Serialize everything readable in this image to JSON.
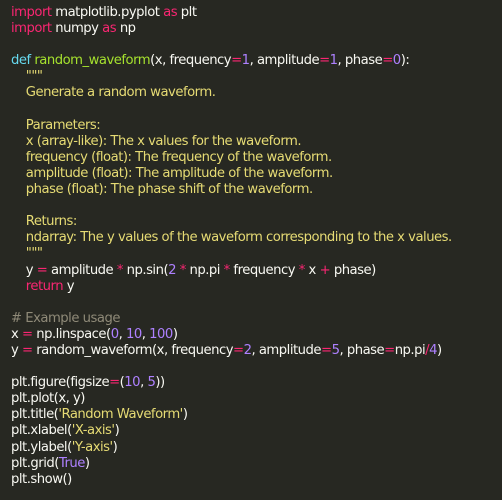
{
  "colors": {
    "background": "#272822",
    "text": "#f8f8f2",
    "keyword": "#f92672",
    "definition": "#66d9ef",
    "function_name": "#a6e22e",
    "number": "#ae81ff",
    "string": "#e6db74",
    "comment": "#8f8a78"
  },
  "code_lines": [
    [
      {
        "t": "kw",
        "v": "import"
      },
      {
        "t": "txt",
        "v": " matplotlib.pyplot "
      },
      {
        "t": "kw",
        "v": "as"
      },
      {
        "t": "txt",
        "v": " plt"
      }
    ],
    [
      {
        "t": "kw",
        "v": "import"
      },
      {
        "t": "txt",
        "v": " numpy "
      },
      {
        "t": "kw",
        "v": "as"
      },
      {
        "t": "txt",
        "v": " np"
      }
    ],
    [],
    [
      {
        "t": "def",
        "v": "def"
      },
      {
        "t": "txt",
        "v": " "
      },
      {
        "t": "fn",
        "v": "random_waveform"
      },
      {
        "t": "txt",
        "v": "(x, frequency"
      },
      {
        "t": "op",
        "v": "="
      },
      {
        "t": "num",
        "v": "1"
      },
      {
        "t": "txt",
        "v": ", amplitude"
      },
      {
        "t": "op",
        "v": "="
      },
      {
        "t": "num",
        "v": "1"
      },
      {
        "t": "txt",
        "v": ", phase"
      },
      {
        "t": "op",
        "v": "="
      },
      {
        "t": "num",
        "v": "0"
      },
      {
        "t": "txt",
        "v": "):"
      }
    ],
    [
      {
        "t": "str",
        "v": "    \"\"\""
      }
    ],
    [
      {
        "t": "str",
        "v": "    Generate a random waveform."
      }
    ],
    [],
    [
      {
        "t": "str",
        "v": "    Parameters:"
      }
    ],
    [
      {
        "t": "str",
        "v": "    x (array-like): The x values for the waveform."
      }
    ],
    [
      {
        "t": "str",
        "v": "    frequency (float): The frequency of the waveform."
      }
    ],
    [
      {
        "t": "str",
        "v": "    amplitude (float): The amplitude of the waveform."
      }
    ],
    [
      {
        "t": "str",
        "v": "    phase (float): The phase shift of the waveform."
      }
    ],
    [],
    [
      {
        "t": "str",
        "v": "    Returns:"
      }
    ],
    [
      {
        "t": "str",
        "v": "    ndarray: The y values of the waveform corresponding to the x values."
      }
    ],
    [
      {
        "t": "str",
        "v": "    \"\"\""
      }
    ],
    [
      {
        "t": "txt",
        "v": "    y "
      },
      {
        "t": "op",
        "v": "="
      },
      {
        "t": "txt",
        "v": " amplitude "
      },
      {
        "t": "op",
        "v": "*"
      },
      {
        "t": "txt",
        "v": " np.sin("
      },
      {
        "t": "num",
        "v": "2"
      },
      {
        "t": "txt",
        "v": " "
      },
      {
        "t": "op",
        "v": "*"
      },
      {
        "t": "txt",
        "v": " np.pi "
      },
      {
        "t": "op",
        "v": "*"
      },
      {
        "t": "txt",
        "v": " frequency "
      },
      {
        "t": "op",
        "v": "*"
      },
      {
        "t": "txt",
        "v": " x "
      },
      {
        "t": "op",
        "v": "+"
      },
      {
        "t": "txt",
        "v": " phase)"
      }
    ],
    [
      {
        "t": "kw",
        "v": "    return"
      },
      {
        "t": "txt",
        "v": " y"
      }
    ],
    [],
    [
      {
        "t": "com",
        "v": "# Example usage"
      }
    ],
    [
      {
        "t": "txt",
        "v": "x "
      },
      {
        "t": "op",
        "v": "="
      },
      {
        "t": "txt",
        "v": " np.linspace("
      },
      {
        "t": "num",
        "v": "0"
      },
      {
        "t": "txt",
        "v": ", "
      },
      {
        "t": "num",
        "v": "10"
      },
      {
        "t": "txt",
        "v": ", "
      },
      {
        "t": "num",
        "v": "100"
      },
      {
        "t": "txt",
        "v": ")"
      }
    ],
    [
      {
        "t": "txt",
        "v": "y "
      },
      {
        "t": "op",
        "v": "="
      },
      {
        "t": "txt",
        "v": " random_waveform(x, frequency"
      },
      {
        "t": "op",
        "v": "="
      },
      {
        "t": "num",
        "v": "2"
      },
      {
        "t": "txt",
        "v": ", amplitude"
      },
      {
        "t": "op",
        "v": "="
      },
      {
        "t": "num",
        "v": "5"
      },
      {
        "t": "txt",
        "v": ", phase"
      },
      {
        "t": "op",
        "v": "="
      },
      {
        "t": "txt",
        "v": "np.pi"
      },
      {
        "t": "op",
        "v": "/"
      },
      {
        "t": "num",
        "v": "4"
      },
      {
        "t": "txt",
        "v": ")"
      }
    ],
    [],
    [
      {
        "t": "txt",
        "v": "plt.figure(figsize"
      },
      {
        "t": "op",
        "v": "="
      },
      {
        "t": "txt",
        "v": "("
      },
      {
        "t": "num",
        "v": "10"
      },
      {
        "t": "txt",
        "v": ", "
      },
      {
        "t": "num",
        "v": "5"
      },
      {
        "t": "txt",
        "v": "))"
      }
    ],
    [
      {
        "t": "txt",
        "v": "plt.plot(x, y)"
      }
    ],
    [
      {
        "t": "txt",
        "v": "plt.title("
      },
      {
        "t": "str",
        "v": "'Random Waveform'"
      },
      {
        "t": "txt",
        "v": ")"
      }
    ],
    [
      {
        "t": "txt",
        "v": "plt.xlabel("
      },
      {
        "t": "str",
        "v": "'X-axis'"
      },
      {
        "t": "txt",
        "v": ")"
      }
    ],
    [
      {
        "t": "txt",
        "v": "plt.ylabel("
      },
      {
        "t": "str",
        "v": "'Y-axis'"
      },
      {
        "t": "txt",
        "v": ")"
      }
    ],
    [
      {
        "t": "txt",
        "v": "plt.grid("
      },
      {
        "t": "const",
        "v": "True"
      },
      {
        "t": "txt",
        "v": ")"
      }
    ],
    [
      {
        "t": "txt",
        "v": "plt.show()"
      }
    ]
  ]
}
